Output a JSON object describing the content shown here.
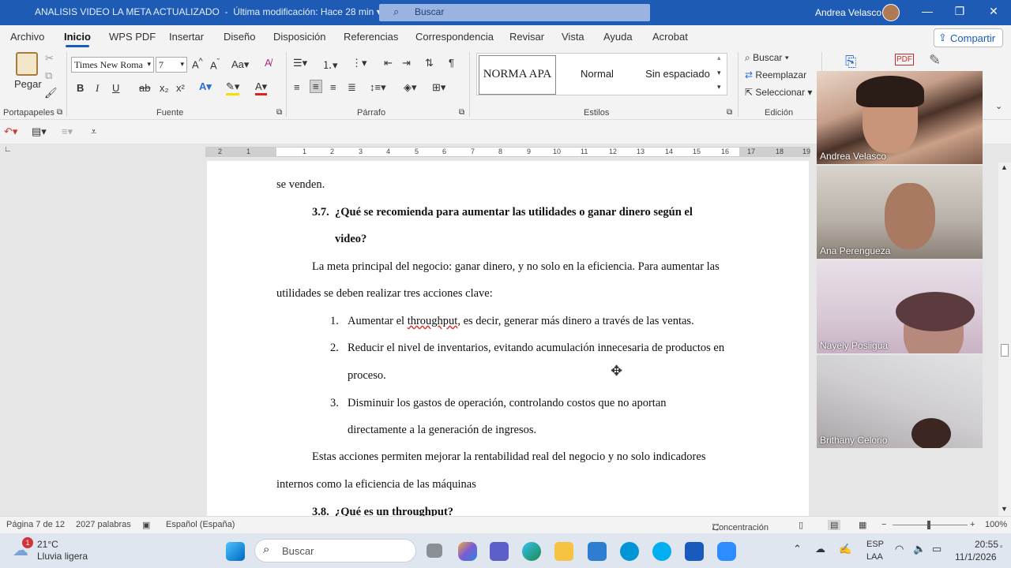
{
  "titlebar": {
    "document": "ANALISIS VIDEO LA META ACTUALIZADO",
    "modified": "Última modificación: Hace 28 min",
    "search_placeholder": "Buscar",
    "user": "Andrea Velasco"
  },
  "menu": {
    "tabs": [
      "Archivo",
      "Inicio",
      "WPS PDF",
      "Insertar",
      "Diseño",
      "Disposición",
      "Referencias",
      "Correspondencia",
      "Revisar",
      "Vista",
      "Ayuda",
      "Acrobat"
    ],
    "share": "Compartir"
  },
  "ribbon": {
    "clipboard": {
      "paste": "Pegar",
      "label": "Portapapeles"
    },
    "font": {
      "name": "Times New Roma",
      "size": "7",
      "label": "Fuente",
      "bold": "B",
      "italic": "I",
      "underline": "U",
      "strike": "ab",
      "sub": "x₂",
      "sup": "x²"
    },
    "paragraph": {
      "label": "Párrafo"
    },
    "styles": {
      "items": [
        "NORMA APA",
        "Normal",
        "Sin espaciado"
      ],
      "label": "Estilos"
    },
    "editing": {
      "find": "Buscar",
      "replace": "Reemplazar",
      "select": "Seleccionar",
      "label": "Edición"
    }
  },
  "ruler": {
    "ticks": [
      "2",
      "1",
      "1",
      "2",
      "3",
      "4",
      "5",
      "6",
      "7",
      "8",
      "9",
      "10",
      "11",
      "12",
      "13",
      "14",
      "15",
      "16",
      "17",
      "18",
      "19"
    ]
  },
  "document": {
    "line_prev": "se venden.",
    "h37_num": "3.7.",
    "h37_line1": "¿Qué se recomienda para aumentar las utilidades o ganar dinero según el",
    "h37_line2": "video?",
    "p1_line1": "La meta principal del negocio: ganar dinero, y no solo en la eficiencia. Para aumentar las",
    "p1_line2": "utilidades se deben realizar tres acciones clave:",
    "list": [
      {
        "num": "1.",
        "pre": "Aumentar el ",
        "err": "throughput",
        "post": ", es decir, generar más dinero a través de las ventas."
      },
      {
        "num": "2.",
        "line1": "Reducir el nivel de inventarios, evitando acumulación innecesaria de productos en",
        "line2": "proceso."
      },
      {
        "num": "3.",
        "line1": "Disminuir los gastos de operación, controlando costos que no aportan",
        "line2": "directamente a la generación de ingresos."
      }
    ],
    "p2_line1": "Estas acciones permiten mejorar la rentabilidad real del negocio y no solo indicadores",
    "p2_line2": "internos como la eficiencia de las máquinas",
    "h38_num": "3.8.",
    "h38_pre": "¿Qué es un ",
    "h38_under": "throughput",
    "h38_post": "?"
  },
  "participants": [
    "Andrea Velasco",
    "Ana Perengueza",
    "Nayely Posligua",
    "Brithany Celorio"
  ],
  "status": {
    "page": "Página 7 de 12",
    "words": "2027 palabras",
    "language": "Español (España)",
    "focus": "Concentración",
    "zoom": "100%"
  },
  "taskbar": {
    "temp": "21°C",
    "weather": "Lluvia ligera",
    "badge": "1",
    "search": "Buscar",
    "lang1": "ESP",
    "lang2": "LAA",
    "time": "20:55",
    "date": "11/1/2026"
  }
}
